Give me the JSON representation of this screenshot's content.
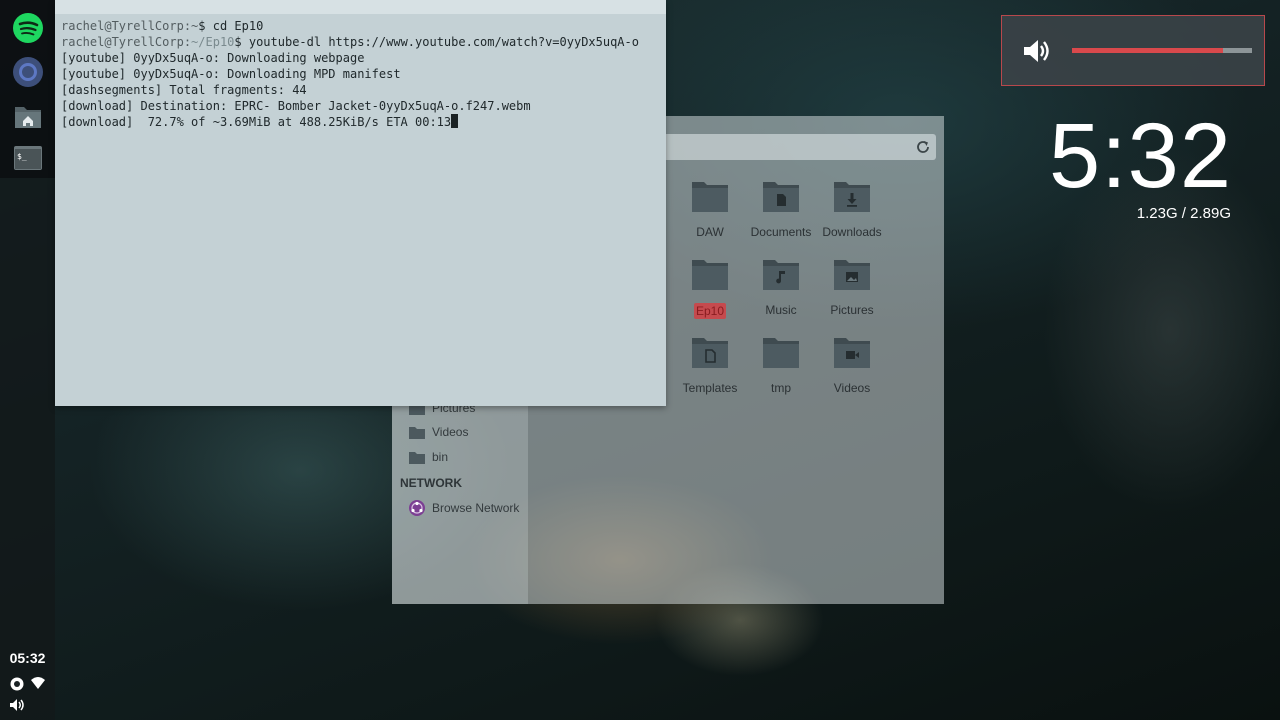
{
  "dock": {
    "apps": [
      {
        "name": "Spotify",
        "icon": "spotify-icon"
      },
      {
        "name": "Chromium",
        "icon": "chromium-icon"
      },
      {
        "name": "Files",
        "icon": "folder-home-icon"
      },
      {
        "name": "Terminal",
        "icon": "terminal-icon"
      }
    ],
    "time": "05:32",
    "tray": [
      "status-icon",
      "wifi-icon",
      "volume-icon"
    ]
  },
  "terminal": {
    "lines": [
      {
        "prompt": "rachel@TyrellCorp:",
        "dir": "~",
        "cmd": "$ cd Ep10"
      },
      {
        "prompt": "rachel@TyrellCorp:",
        "dir": "~/Ep10",
        "cmd": "$ youtube-dl https://www.youtube.com/watch?v=0yyDx5uqA-o"
      }
    ],
    "output": [
      "[youtube] 0yyDx5uqA-o: Downloading webpage",
      "[youtube] 0yyDx5uqA-o: Downloading MPD manifest",
      "[dashsegments] Total fragments: 44",
      "[download] Destination: EPRC- Bomber Jacket-0yyDx5uqA-o.f247.webm",
      "[download]  72.7% of ~3.69MiB at 488.25KiB/s ETA 00:13"
    ]
  },
  "filemanager": {
    "sidebar": {
      "places": [
        {
          "label": "Pictures",
          "icon": "folder-icon"
        },
        {
          "label": "Videos",
          "icon": "folder-icon"
        },
        {
          "label": "bin",
          "icon": "folder-icon"
        }
      ],
      "network_header": "NETWORK",
      "network_items": [
        {
          "label": "Browse Network",
          "icon": "network-icon"
        }
      ]
    },
    "files": [
      {
        "label": "DAW",
        "emblem": ""
      },
      {
        "label": "Documents",
        "emblem": "document"
      },
      {
        "label": "Downloads",
        "emblem": "download"
      },
      {
        "label": "Ep10",
        "emblem": "",
        "selected": true
      },
      {
        "label": "Music",
        "emblem": "music"
      },
      {
        "label": "Pictures",
        "emblem": "picture"
      },
      {
        "label": "Templates",
        "emblem": "template"
      },
      {
        "label": "tmp",
        "emblem": ""
      },
      {
        "label": "Videos",
        "emblem": "video"
      }
    ]
  },
  "volume": {
    "level": 0.84,
    "icon": "speaker-icon"
  },
  "widget": {
    "clock": "5:32",
    "memory": "1.23G / 2.89G"
  },
  "colors": {
    "accent": "#d9494c",
    "terminal_bg": "#c4d1d5",
    "folder": "#3f4b50"
  }
}
